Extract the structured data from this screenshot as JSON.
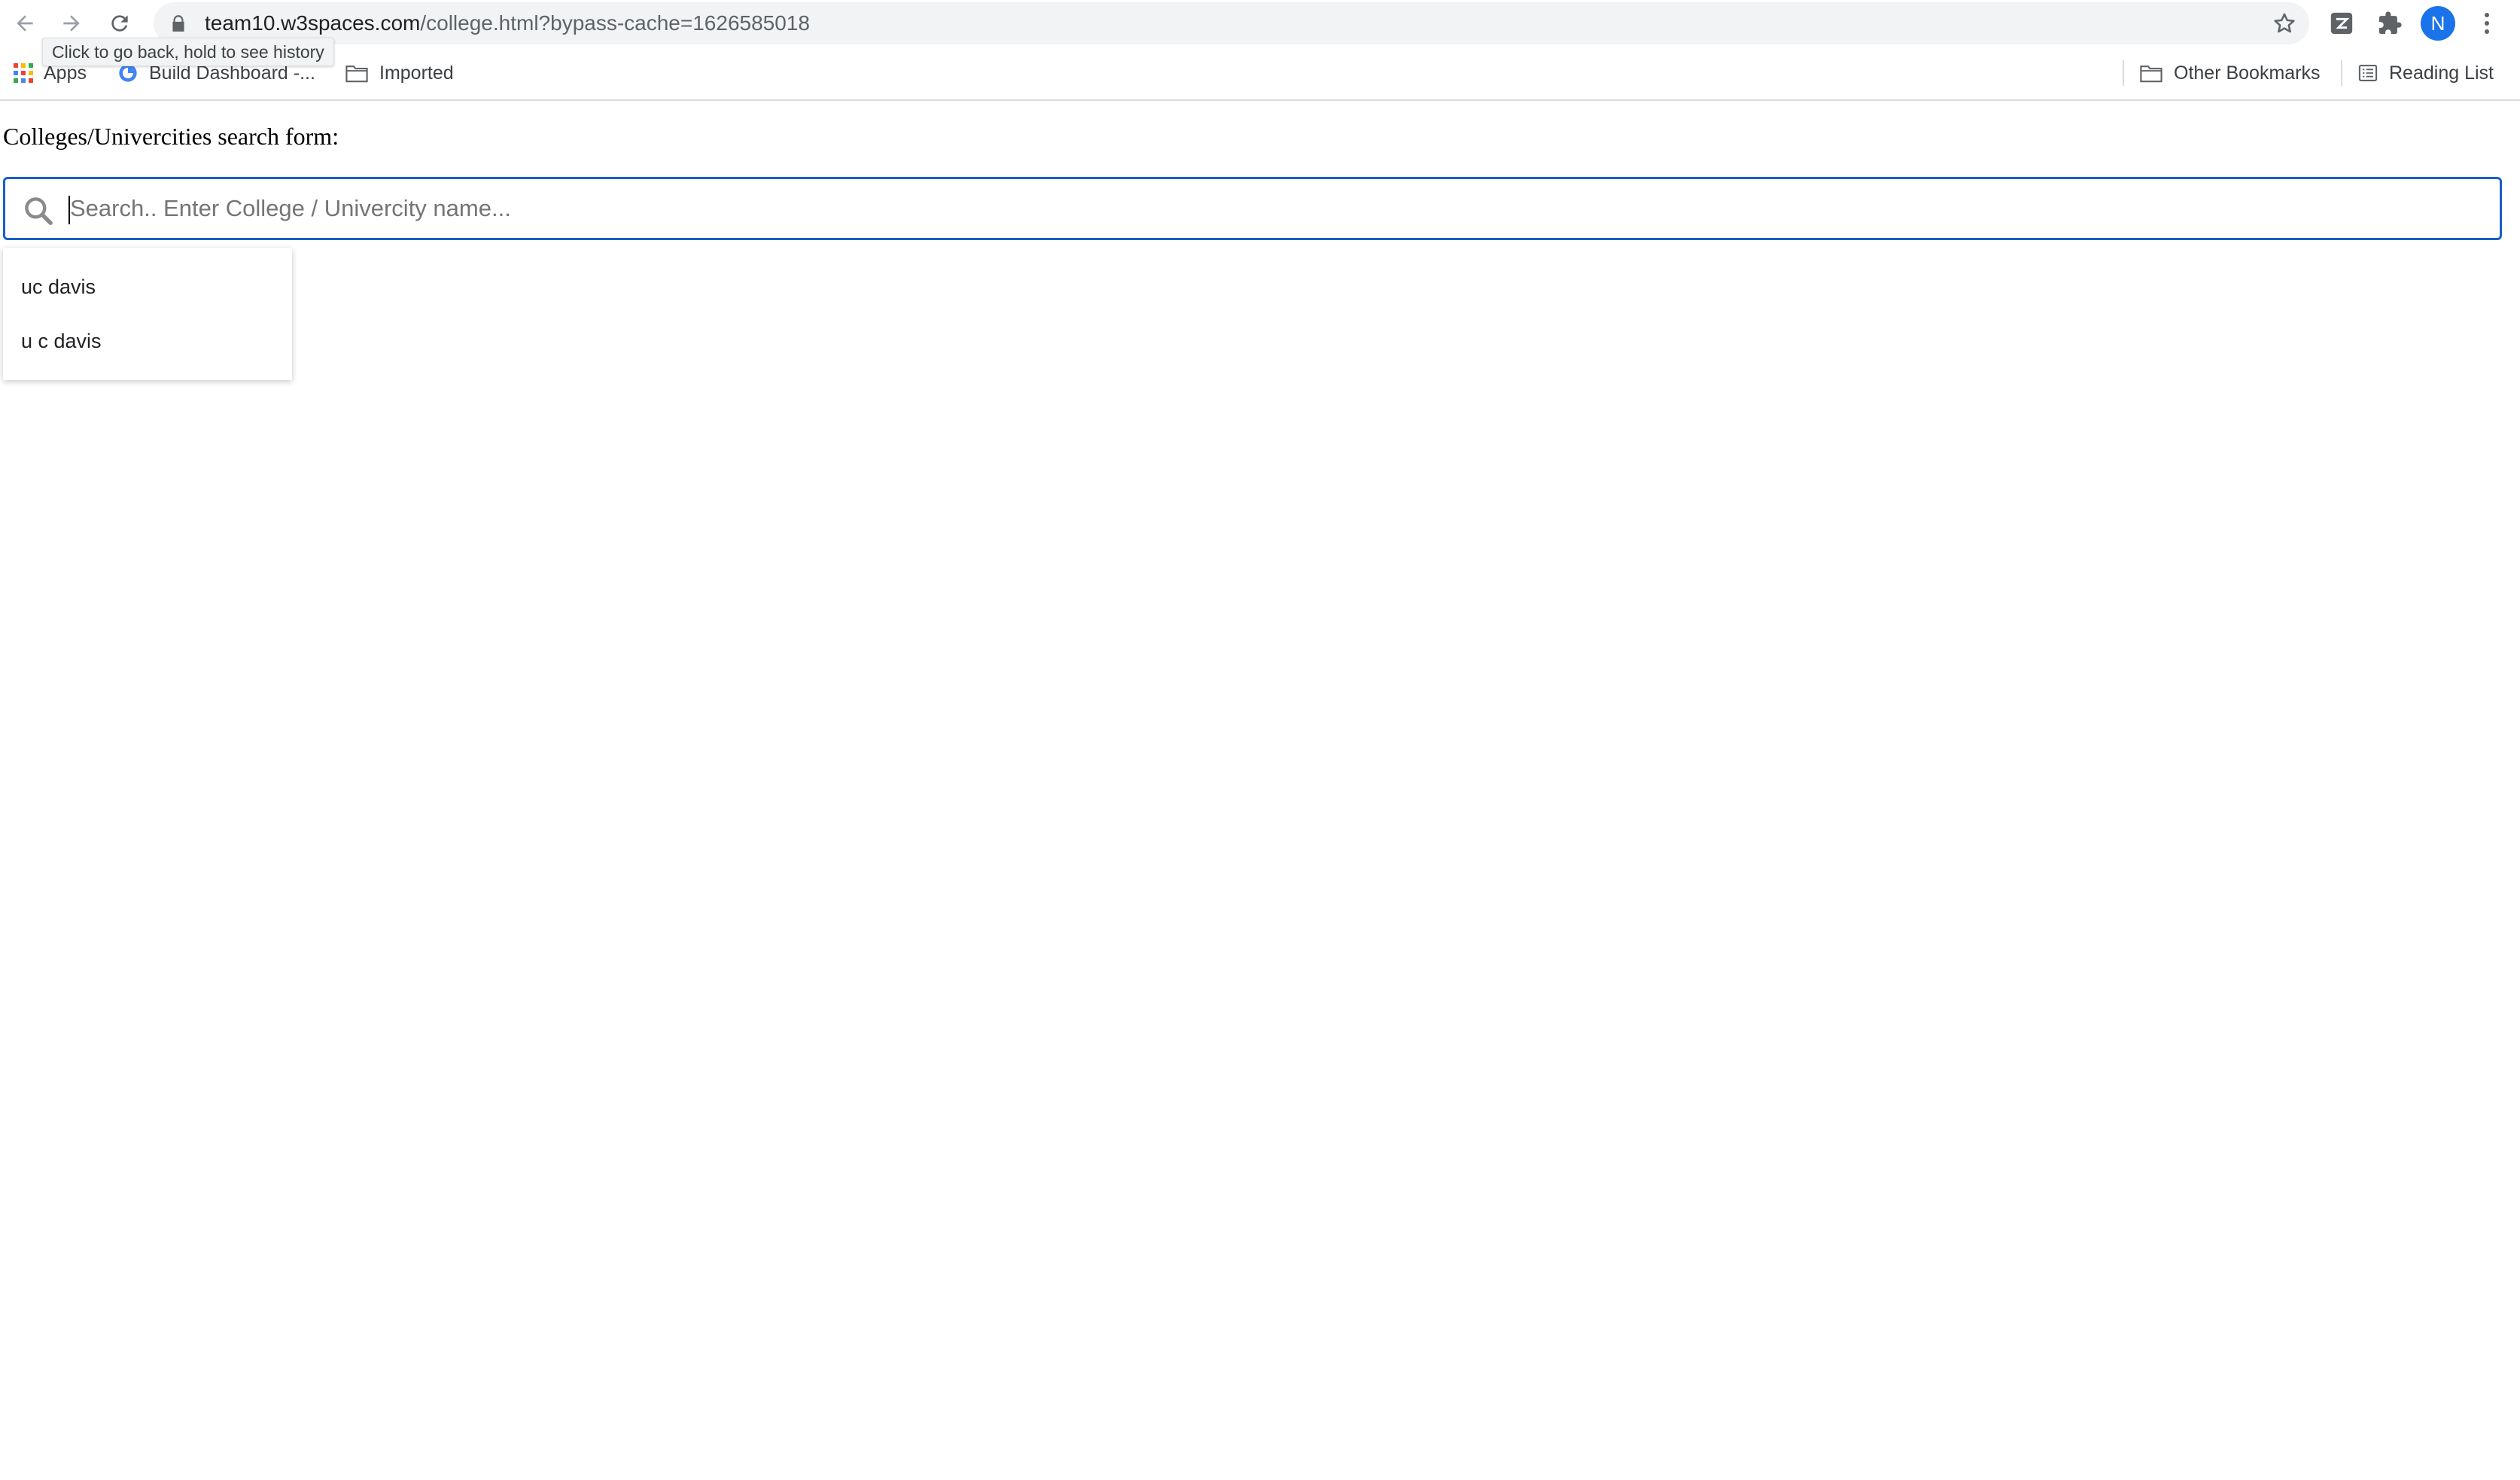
{
  "browser": {
    "url_host": "team10.w3spaces.com",
    "url_path": "/college.html?bypass-cache=1626585018",
    "tooltip": "Click to go back, hold to see history",
    "profile_initial": "N",
    "bookmarks": {
      "apps": "Apps",
      "build_dashboard": "Build Dashboard -...",
      "imported": "Imported",
      "other_bookmarks": "Other Bookmarks",
      "reading_list": "Reading List"
    }
  },
  "page": {
    "title": "Colleges/Univercities search form:",
    "search": {
      "value": "",
      "placeholder": "Search.. Enter College / Univercity name..."
    },
    "suggestions": [
      "uc davis",
      "u c davis"
    ]
  },
  "colors": {
    "focus_border": "#1a5fcc",
    "avatar": "#1a73e8"
  }
}
